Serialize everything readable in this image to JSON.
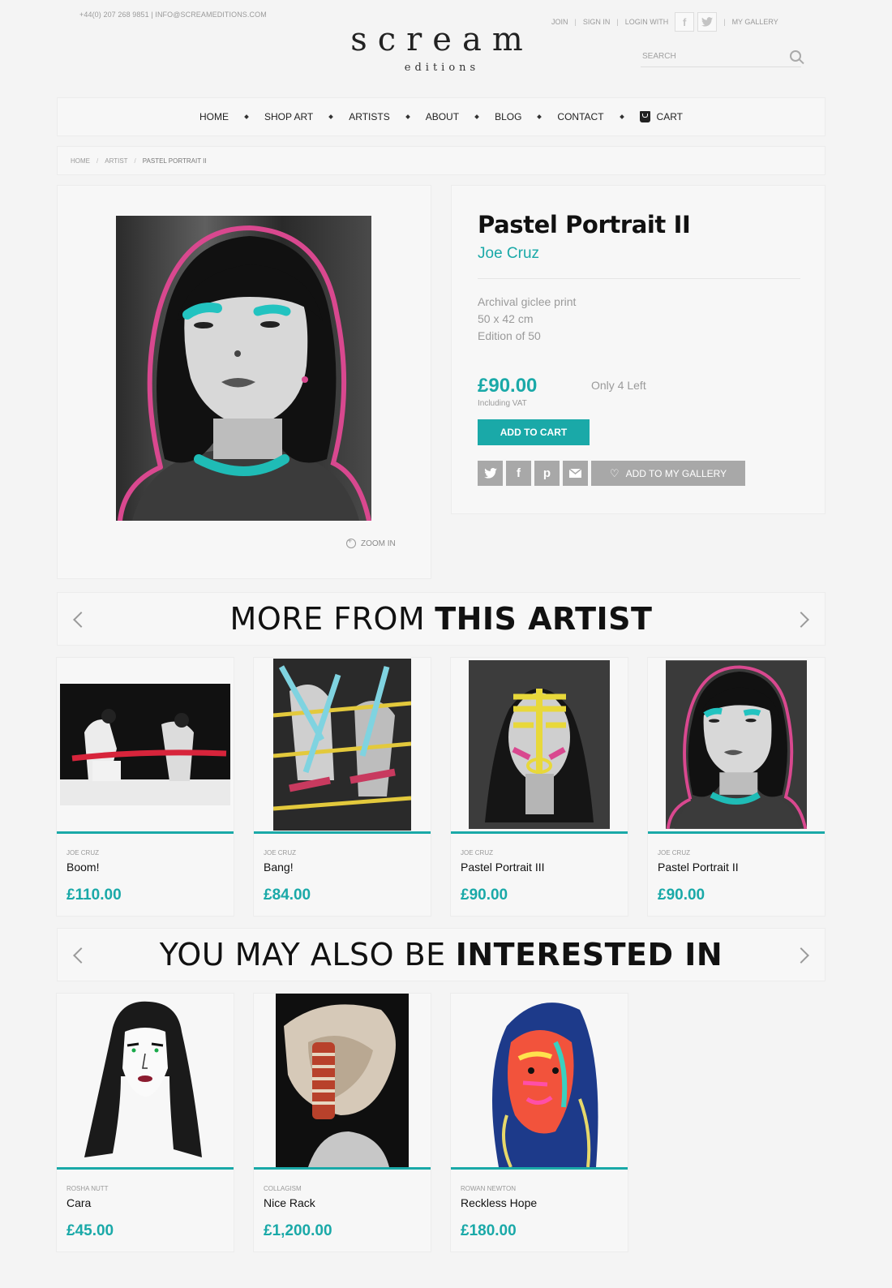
{
  "header": {
    "contact": "+44(0) 207 268 9851 | INFO@SCREAMEDITIONS.COM",
    "logo_main": "scream",
    "logo_sub": "editions",
    "links": {
      "join": "JOIN",
      "signin": "SIGN IN",
      "login_with": "LOGIN WITH",
      "my_gallery": "MY GALLERY"
    },
    "search_placeholder": "SEARCH"
  },
  "nav": {
    "items": [
      "HOME",
      "SHOP ART",
      "ARTISTS",
      "ABOUT",
      "BLOG",
      "CONTACT",
      "CART"
    ]
  },
  "breadcrumb": [
    "HOME",
    "ARTIST",
    "PASTEL PORTRAIT II"
  ],
  "product": {
    "title": "Pastel Portrait II",
    "artist": "Joe Cruz",
    "specs": [
      "Archival giclee print",
      "50 x 42 cm",
      "Edition of 50"
    ],
    "price": "£90.00",
    "vat_note": "Including VAT",
    "stock": "Only 4 Left",
    "add_to_cart": "ADD TO CART",
    "add_to_gallery": "ADD TO MY GALLERY",
    "zoom": "ZOOM IN"
  },
  "more_from_artist": {
    "heading_light": "MORE FROM",
    "heading_bold": "THIS ARTIST",
    "items": [
      {
        "artist": "JOE CRUZ",
        "name": "Boom!",
        "price": "£110.00"
      },
      {
        "artist": "JOE CRUZ",
        "name": "Bang!",
        "price": "£84.00"
      },
      {
        "artist": "JOE CRUZ",
        "name": "Pastel Portrait III",
        "price": "£90.00"
      },
      {
        "artist": "JOE CRUZ",
        "name": "Pastel Portrait II",
        "price": "£90.00"
      }
    ]
  },
  "also_interested": {
    "heading_light": "YOU MAY ALSO BE",
    "heading_bold": "INTERESTED IN",
    "items": [
      {
        "artist": "ROSHA NUTT",
        "name": "Cara",
        "price": "£45.00"
      },
      {
        "artist": "COLLAGISM",
        "name": "Nice Rack",
        "price": "£1,200.00"
      },
      {
        "artist": "ROWAN NEWTON",
        "name": "Reckless Hope",
        "price": "£180.00"
      }
    ]
  },
  "colors": {
    "accent": "#1aa9a8",
    "pink": "#d9488f",
    "grey_button": "#a8a8a8"
  }
}
